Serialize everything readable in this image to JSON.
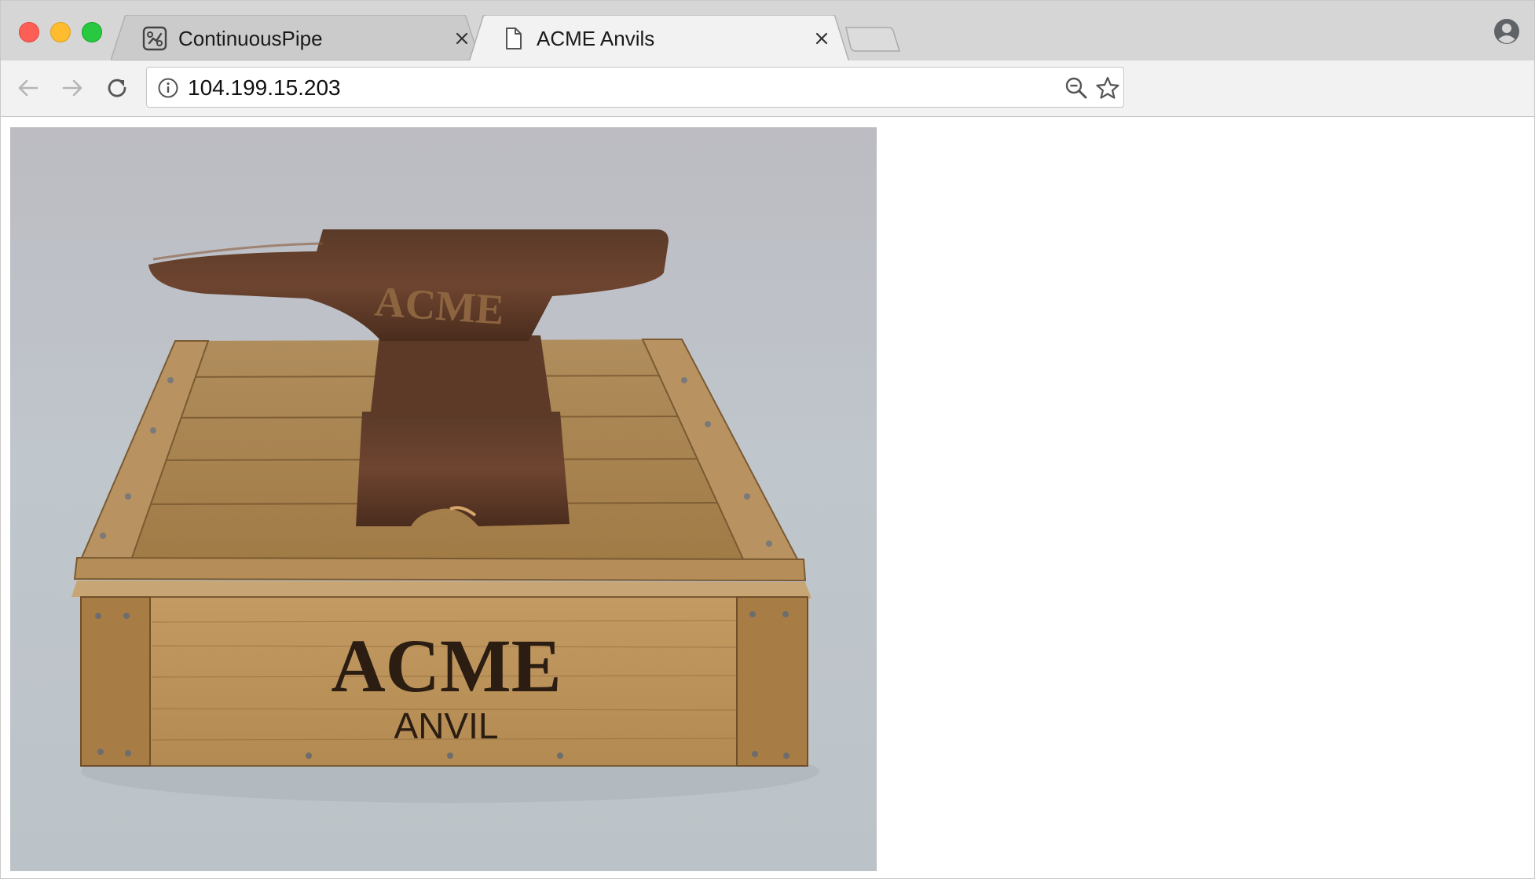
{
  "browser": {
    "tabs": [
      {
        "title": "ContinuousPipe",
        "favicon": "continuouspipe-logo-icon",
        "active": false
      },
      {
        "title": "ACME Anvils",
        "favicon": "page-icon",
        "active": true
      }
    ],
    "address_bar": {
      "url": "104.199.15.203"
    }
  },
  "page": {
    "image": {
      "subject": "anvil on wooden crate",
      "anvil_text": "ACME",
      "crate_text_main": "ACME",
      "crate_text_sub": "ANVIL"
    }
  },
  "colors": {
    "tabstrip": "#d6d6d6",
    "active_tab": "#f2f2f2",
    "inactive_tab": "#cbcbcb",
    "toolbar": "#f2f2f2",
    "close_light": "#fd5f57",
    "minimize_light": "#febc2e",
    "maximize_light": "#28c840"
  }
}
